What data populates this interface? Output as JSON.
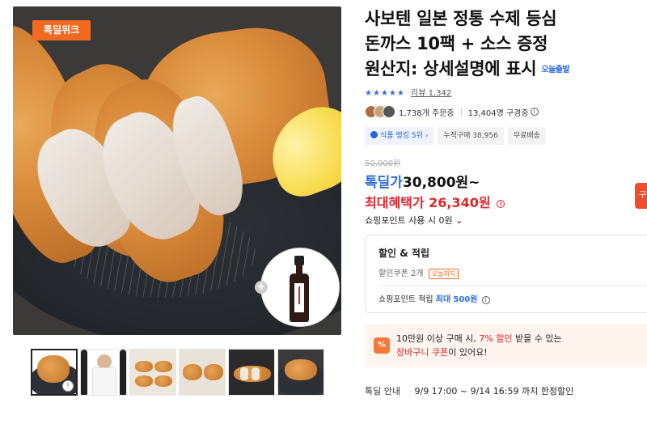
{
  "gallery": {
    "promo_tag": "톡딜위크",
    "plus_symbol": "+",
    "video_symbol": "!"
  },
  "product": {
    "title_line1": "사보텐 일본 정통 수제 등심",
    "title_line2": "돈까스 10팩 + 소스 증정",
    "title_line3": "원산지: 상세설명에 표시",
    "today_delivery": "오늘출발",
    "stars": "★★★★★",
    "review_label": "리뷰",
    "review_count": "1,342",
    "order_count": "1,738개 주문중",
    "watch_count": "13,404명 구경중",
    "chips": [
      "식품 랭킹 5위",
      "누적구매 38,956",
      "무료배송"
    ]
  },
  "price": {
    "original": "50,000원",
    "deal_label": "톡딜가",
    "deal_value": "30,800원~",
    "max_benefit": "최대혜택가 26,340원",
    "points_use": "쇼핑포인트 사용 시 0원"
  },
  "discount": {
    "title": "할인 & 적립",
    "coupon_text": "할인쿠폰 2개",
    "coupon_tag": "오늘까지",
    "accrual_label": "쇼핑포인트 적립",
    "accrual_max": "최대",
    "accrual_value": "500원"
  },
  "cart_banner": {
    "icon": "%",
    "line1_pre": "10만원 이상 구매 시, ",
    "line1_hl": "7% 할인",
    "line1_post": " 받을 수 있는",
    "line2_hl": "장바구니 쿠폰",
    "line2_post": "이 있어요!"
  },
  "deal_info": {
    "label": "톡딜 안내",
    "period": "9/9 17:00 ~ 9/14 16:59 까지 한정할인"
  },
  "buy_button": {
    "label": "구"
  }
}
